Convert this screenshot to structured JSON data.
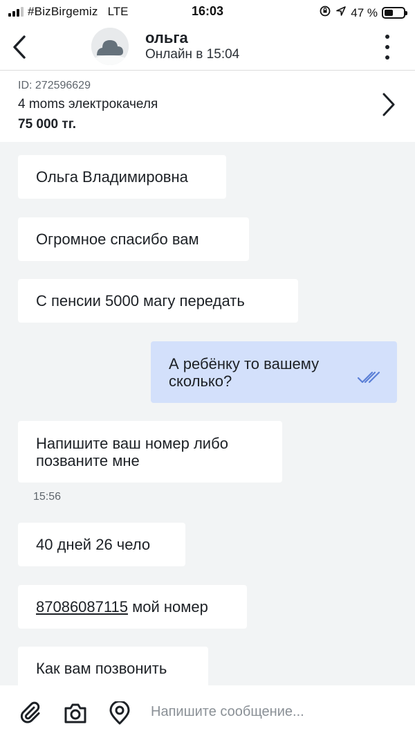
{
  "status_bar": {
    "carrier": "#BizBirgemiz",
    "network": "LTE",
    "time": "16:03",
    "battery": "47 %",
    "battery_level": 0.47
  },
  "header": {
    "contact_name": "ольга",
    "contact_status": "Онлайн в 15:04"
  },
  "listing": {
    "id": "ID: 272596629",
    "title": "4 moms электрокачеля",
    "price": "75 000 тг."
  },
  "messages": [
    {
      "direction": "in",
      "text": "Ольга Владимировна"
    },
    {
      "direction": "in",
      "text": "Огромное спасибо вам"
    },
    {
      "direction": "in",
      "text": "С пенсии 5000 магу передать"
    },
    {
      "direction": "out",
      "text_line1": "А ребёнку то вашему",
      "text_line2": "сколько?",
      "status": "read"
    },
    {
      "direction": "in",
      "text_line1": "Напишите ваш номер либо",
      "text_line2": "позваните мне"
    },
    {
      "timestamp": "15:56"
    },
    {
      "direction": "in",
      "text": "40 дней 26 чело"
    },
    {
      "direction": "in",
      "phone": "87086087115",
      "text": " мой номер"
    },
    {
      "direction": "in",
      "text": "Как вам позвонить"
    }
  ],
  "input": {
    "placeholder": "Напишите сообщение..."
  },
  "colors": {
    "background_messages": "#f2f4f5",
    "outgoing_bubble": "#d3e0fb",
    "incoming_bubble": "#ffffff",
    "read_ticks": "#5b7fd6"
  },
  "icons": {
    "back": "chevron-left-icon",
    "more": "more-vertical-icon",
    "listing_open": "chevron-right-icon",
    "attach": "paperclip-icon",
    "camera": "camera-icon",
    "location": "location-pin-icon"
  }
}
